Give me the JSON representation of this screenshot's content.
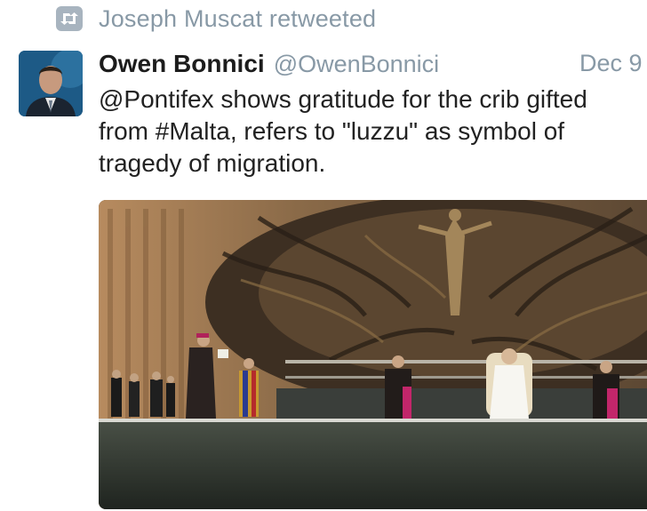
{
  "retweet": {
    "label": "Joseph Muscat retweeted",
    "icon": "retweet-icon"
  },
  "tweet": {
    "author_name": "Owen Bonnici",
    "author_handle": "@OwenBonnici",
    "date": "Dec 9",
    "text_lines": [
      "@Pontifex shows gratitude for the crib gifted",
      "from #Malta, refers to \"luzzu\" as symbol of",
      "tragedy of migration."
    ]
  },
  "colors": {
    "muted": "#8899a6",
    "text": "#222222",
    "icon_bg": "#a8b4bf"
  }
}
